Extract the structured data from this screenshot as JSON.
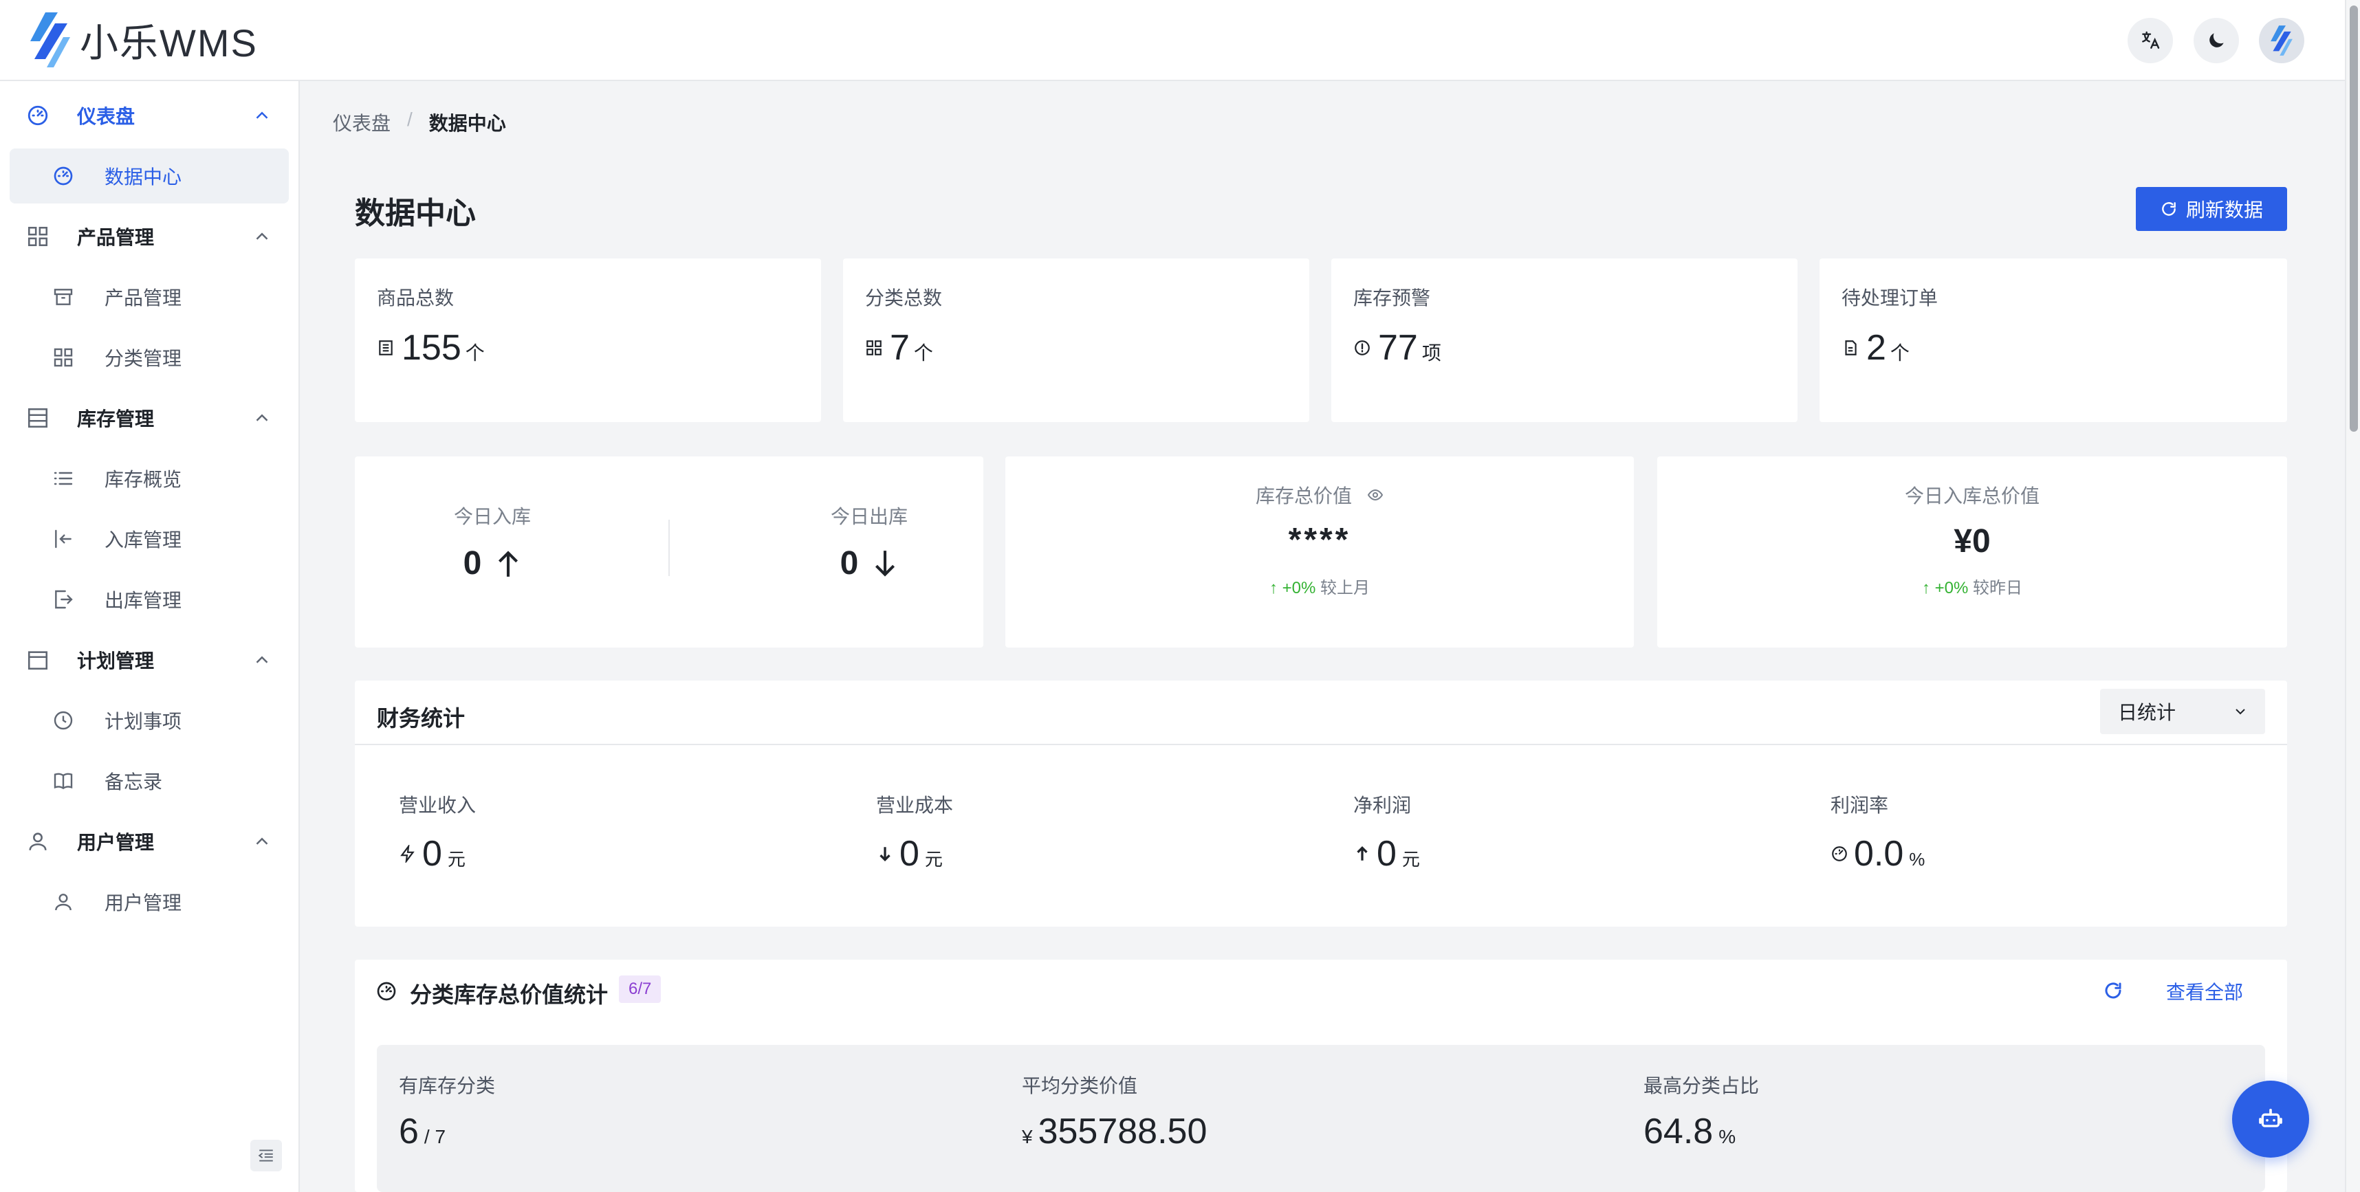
{
  "app": {
    "name": "小乐WMS"
  },
  "header": {
    "translate_icon": "translate-icon",
    "theme_icon": "moon-icon"
  },
  "sidebar": {
    "groups": [
      {
        "label": "仪表盘",
        "icon": "dashboard-icon",
        "active": true,
        "items": [
          {
            "label": "数据中心",
            "icon": "dashboard-icon",
            "active": true
          }
        ]
      },
      {
        "label": "产品管理",
        "icon": "grid-icon",
        "items": [
          {
            "label": "产品管理",
            "icon": "archive-icon"
          },
          {
            "label": "分类管理",
            "icon": "grid-icon"
          }
        ]
      },
      {
        "label": "库存管理",
        "icon": "inventory-icon",
        "items": [
          {
            "label": "库存概览",
            "icon": "list-icon"
          },
          {
            "label": "入库管理",
            "icon": "login-icon"
          },
          {
            "label": "出库管理",
            "icon": "logout-icon"
          }
        ]
      },
      {
        "label": "计划管理",
        "icon": "calendar-icon",
        "items": [
          {
            "label": "计划事项",
            "icon": "clock-icon"
          },
          {
            "label": "备忘录",
            "icon": "book-icon"
          }
        ]
      },
      {
        "label": "用户管理",
        "icon": "user-icon",
        "items": [
          {
            "label": "用户管理",
            "icon": "user-icon"
          }
        ]
      }
    ]
  },
  "breadcrumb": {
    "parent": "仪表盘",
    "separator": "/",
    "current": "数据中心"
  },
  "page": {
    "title": "数据中心",
    "refresh_label": "刷新数据"
  },
  "stats": [
    {
      "label": "商品总数",
      "value": "155",
      "unit": "个",
      "icon": "list-icon"
    },
    {
      "label": "分类总数",
      "value": "7",
      "unit": "个",
      "icon": "grid-icon"
    },
    {
      "label": "库存预警",
      "value": "77",
      "unit": "项",
      "icon": "alert-icon"
    },
    {
      "label": "待处理订单",
      "value": "2",
      "unit": "个",
      "icon": "document-icon"
    }
  ],
  "today": {
    "in_label": "今日入库",
    "in_value": "0",
    "out_label": "今日出库",
    "out_value": "0"
  },
  "inventory_value": {
    "label": "库存总价值",
    "value": "****",
    "change": "+0%",
    "compare": "较上月"
  },
  "today_in_value": {
    "label": "今日入库总价值",
    "value": "¥0",
    "change": "+0%",
    "compare": "较昨日"
  },
  "finance": {
    "title": "财务统计",
    "period": "日统计",
    "items": [
      {
        "label": "营业收入",
        "value": "0",
        "unit": "元",
        "icon": "flash-icon"
      },
      {
        "label": "营业成本",
        "value": "0",
        "unit": "元",
        "icon": "arrow-down-icon"
      },
      {
        "label": "净利润",
        "value": "0",
        "unit": "元",
        "icon": "arrow-up-icon"
      },
      {
        "label": "利润率",
        "value": "0.0",
        "unit": "%",
        "icon": "gauge-icon"
      }
    ]
  },
  "category": {
    "title": "分类库存总价值统计",
    "badge": "6/7",
    "view_all": "查看全部",
    "summary": [
      {
        "label": "有库存分类",
        "value": "6",
        "suffix": "/ 7"
      },
      {
        "label": "平均分类价值",
        "prefix": "¥",
        "value": "355788.50"
      },
      {
        "label": "最高分类占比",
        "value": "64.8",
        "suffix": "%"
      }
    ]
  },
  "colors": {
    "primary": "#2b5fe6",
    "up": "#34b233",
    "badge_bg": "#f1e8fb",
    "badge_fg": "#8b3fd1"
  }
}
